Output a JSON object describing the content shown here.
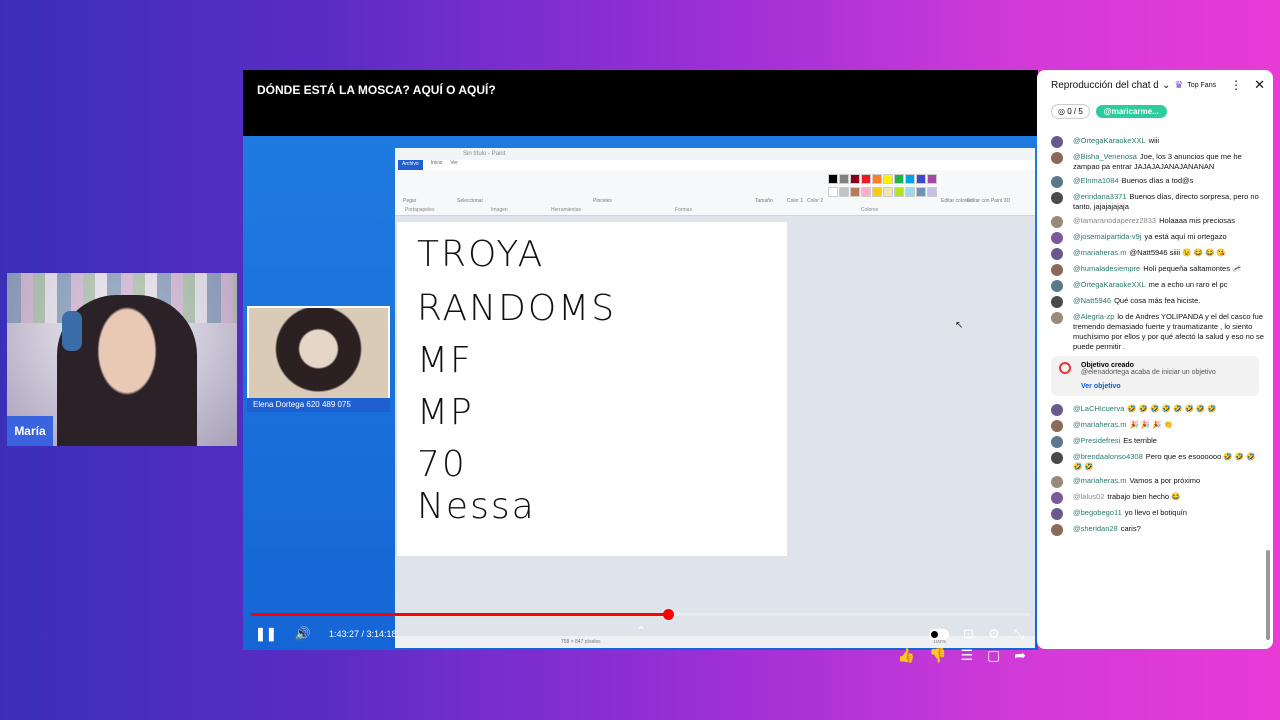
{
  "webcam": {
    "name": "María"
  },
  "video": {
    "title": "DÓNDE ESTÁ LA MOSCA? AQUÍ O AQUÍ?",
    "inset_name": "Elena Dortega 620 489 075",
    "time": "1:43:27 / 3:14:18",
    "progress_fraction": 0.535
  },
  "paint": {
    "title": "Sin título - Paint",
    "tabs": [
      "Archivo",
      "Inicio",
      "Ver"
    ],
    "groups": [
      "Portapapeles",
      "Imagen",
      "Herramientas",
      "Formas",
      "Colores"
    ],
    "tools": [
      "Pegar",
      "Seleccionar",
      "Pinceles",
      "Tamaño",
      "Color 1",
      "Color 2",
      "Editar colores",
      "Editar con Paint 3D"
    ],
    "canvas_lines": [
      "TROYA",
      "RANDOMS",
      "MF",
      "MP",
      "70",
      "Nessa"
    ],
    "status_size": "758 × 847 píxeles",
    "zoom": "100%",
    "palette": [
      "#000000",
      "#7f7f7f",
      "#880015",
      "#ed1c24",
      "#ff7f27",
      "#fff200",
      "#22b14c",
      "#00a2e8",
      "#3f48cc",
      "#a349a4",
      "#ffffff",
      "#c3c3c3",
      "#b97a57",
      "#ffaec9",
      "#ffc90e",
      "#efe4b0",
      "#b5e61d",
      "#99d9ea",
      "#7092be",
      "#c8bfe7"
    ]
  },
  "chat": {
    "header_title": "Reproducción del chat d...",
    "top_fans": "Top Fans",
    "goal_count": "0 / 5",
    "user_pill": "@maricarme...",
    "messages_top": [
      {
        "author": "@OrtegaKaraokeXXL",
        "text": "wiii"
      },
      {
        "author": "@Bisha_Venenosa",
        "text": "Joe, los 3 anuncios que me he zampao pa entrar JAJAJAJANAJANANAN"
      },
      {
        "author": "@Elnma1084",
        "text": "Buenos días a tod@s"
      },
      {
        "author": "@erindana3371",
        "text": "Buenos días, directo sorpresa, pero no tanto, jajajajajaja"
      },
      {
        "author": "@tamaranodaperez2833",
        "text": "Holaaaa mis preciosas",
        "plain": true
      },
      {
        "author": "@josemalpartida-v9j",
        "text": "ya está aquí mi ortegazo"
      },
      {
        "author": "@mariaheras.m",
        "text": "@Natt5946 siiii 😉 😂 😂 😘"
      },
      {
        "author": "@humaladesiempre",
        "text": "Holi pequeña saltamontes 🦟"
      },
      {
        "author": "@OrtegaKaraokeXXL",
        "text": "me a echo un raro el pc"
      },
      {
        "author": "@Natt5946",
        "text": "Qué cosa más fea hiciste."
      },
      {
        "author": "@Alegria-zp",
        "text": "lo de Andres YOLIPANDA y el del casco fue tremendo demasiado fuerte y traumatizante , lo siento muchísimo por ellos y por qué afectó la salud y eso no se puede permitir ."
      }
    ],
    "goal_card": {
      "title": "Objetivo creado",
      "desc": "@elenadortega acaba de iniciar un objetivo",
      "link": "Ver objetivo"
    },
    "messages_bottom": [
      {
        "author": "@LaCHIcuerva",
        "text": "🤣 🤣 🤣 🤣 🤣 🤣 🤣 🤣"
      },
      {
        "author": "@mariaheras.m",
        "text": "🎉 🎉 🎉 👏"
      },
      {
        "author": "@Presidefresi",
        "text": "Es terrible"
      },
      {
        "author": "@brendaalonso4308",
        "text": "Pero que es esoooooo 🤣 🤣 🤣 🤣 🤣"
      },
      {
        "author": "@mariaheras.m",
        "text": "Vamos a por próximo"
      },
      {
        "author": "@lalus02",
        "text": "trabajo bien hecho 😂",
        "plain": true
      },
      {
        "author": "@begobego11",
        "text": "yo llevo el botiquín"
      },
      {
        "author": "@sheridan28",
        "text": "caris?"
      }
    ]
  }
}
